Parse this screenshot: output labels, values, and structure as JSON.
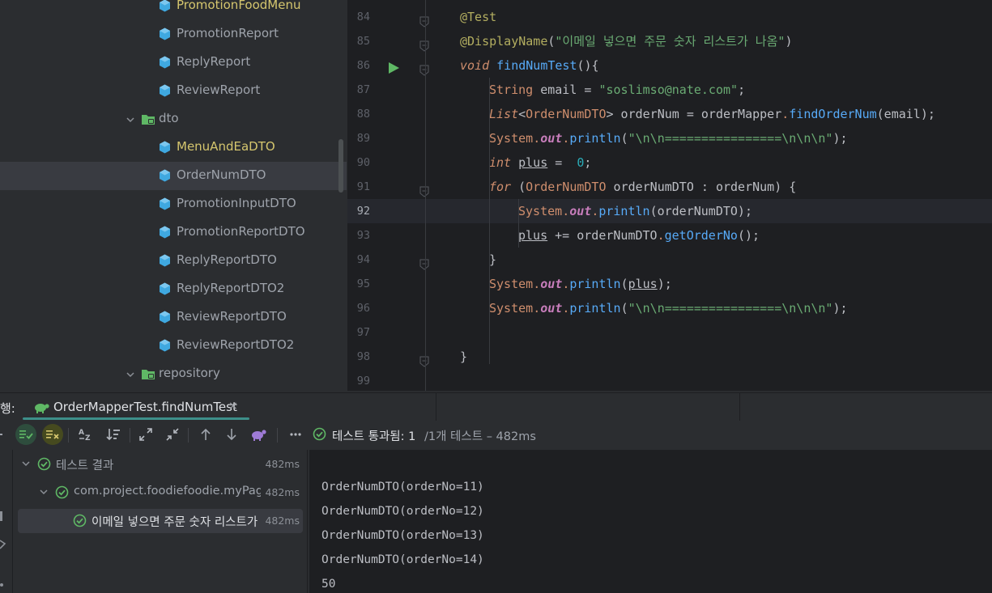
{
  "project_tree": {
    "items": [
      {
        "label": "PromotionFoodMenu",
        "kind": "class",
        "state": "modified"
      },
      {
        "label": "PromotionReport",
        "kind": "class",
        "state": "normal"
      },
      {
        "label": "ReplyReport",
        "kind": "class",
        "state": "normal"
      },
      {
        "label": "ReviewReport",
        "kind": "class",
        "state": "normal"
      },
      {
        "label": "dto",
        "kind": "package",
        "state": "normal"
      },
      {
        "label": "MenuAndEaDTO",
        "kind": "class",
        "state": "modified"
      },
      {
        "label": "OrderNumDTO",
        "kind": "class",
        "state": "selected"
      },
      {
        "label": "PromotionInputDTO",
        "kind": "class",
        "state": "normal"
      },
      {
        "label": "PromotionReportDTO",
        "kind": "class",
        "state": "normal"
      },
      {
        "label": "ReplyReportDTO",
        "kind": "class",
        "state": "normal"
      },
      {
        "label": "ReplyReportDTO2",
        "kind": "class",
        "state": "normal"
      },
      {
        "label": "ReviewReportDTO",
        "kind": "class",
        "state": "normal"
      },
      {
        "label": "ReviewReportDTO2",
        "kind": "class",
        "state": "normal"
      },
      {
        "label": "repository",
        "kind": "package",
        "state": "normal"
      }
    ]
  },
  "editor": {
    "current_line": "92",
    "lines": [
      {
        "n": "84",
        "indent": 1,
        "tokens": [
          [
            "ann",
            "@Test"
          ]
        ]
      },
      {
        "n": "85",
        "indent": 1,
        "tokens": [
          [
            "ann",
            "@DisplayName"
          ],
          [
            "p",
            "("
          ],
          [
            "str",
            "\"이메일 넣으면 주문 숫자 리스트가 나옴\""
          ],
          [
            "p",
            ")"
          ]
        ]
      },
      {
        "n": "86",
        "indent": 1,
        "tokens": [
          [
            "kwi",
            "void"
          ],
          [
            "p",
            " "
          ],
          [
            "fn",
            "findNumTest"
          ],
          [
            "p",
            "(){"
          ]
        ]
      },
      {
        "n": "87",
        "indent": 2,
        "tokens": [
          [
            "kw",
            "String"
          ],
          [
            "p",
            " email = "
          ],
          [
            "str",
            "\"soslimso@nate.com\""
          ],
          [
            "p",
            ";"
          ]
        ]
      },
      {
        "n": "88",
        "indent": 2,
        "tokens": [
          [
            "kwi",
            "List"
          ],
          [
            "p",
            "<"
          ],
          [
            "kw",
            "OrderNumDTO"
          ],
          [
            "p",
            "> orderNum = orderMapper"
          ],
          [
            "kw",
            "."
          ],
          [
            "fn",
            "findOrderNum"
          ],
          [
            "p",
            "(email);"
          ]
        ]
      },
      {
        "n": "89",
        "indent": 2,
        "tokens": [
          [
            "kw",
            "System"
          ],
          [
            "kw",
            "."
          ],
          [
            "fld",
            "out"
          ],
          [
            "kw",
            "."
          ],
          [
            "fn",
            "println"
          ],
          [
            "p",
            "("
          ],
          [
            "str",
            "\"\\n\\n================\\n\\n\\n\""
          ],
          [
            "p",
            ");"
          ]
        ]
      },
      {
        "n": "90",
        "indent": 2,
        "tokens": [
          [
            "kwi",
            "int"
          ],
          [
            "p",
            " "
          ],
          [
            "var",
            "plus"
          ],
          [
            "p",
            " =  "
          ],
          [
            "num",
            "0"
          ],
          [
            "p",
            ";"
          ]
        ]
      },
      {
        "n": "91",
        "indent": 2,
        "tokens": [
          [
            "kwi",
            "for"
          ],
          [
            "p",
            " ("
          ],
          [
            "kw",
            "OrderNumDTO"
          ],
          [
            "p",
            " orderNumDTO : orderNum) {"
          ]
        ]
      },
      {
        "n": "92",
        "indent": 3,
        "tokens": [
          [
            "kw",
            "System"
          ],
          [
            "kw",
            "."
          ],
          [
            "fld",
            "out"
          ],
          [
            "kw",
            "."
          ],
          [
            "fn",
            "println"
          ],
          [
            "p",
            "(orderNumDTO);"
          ]
        ]
      },
      {
        "n": "93",
        "indent": 3,
        "tokens": [
          [
            "var",
            "plus"
          ],
          [
            "p",
            " += orderNumDTO"
          ],
          [
            "kw",
            "."
          ],
          [
            "fn",
            "getOrderNo"
          ],
          [
            "p",
            "();"
          ]
        ]
      },
      {
        "n": "94",
        "indent": 2,
        "tokens": [
          [
            "p",
            "}"
          ]
        ]
      },
      {
        "n": "95",
        "indent": 2,
        "tokens": [
          [
            "kw",
            "System"
          ],
          [
            "kw",
            "."
          ],
          [
            "fld",
            "out"
          ],
          [
            "kw",
            "."
          ],
          [
            "fn",
            "println"
          ],
          [
            "p",
            "("
          ],
          [
            "var",
            "plus"
          ],
          [
            "p",
            ");"
          ]
        ]
      },
      {
        "n": "96",
        "indent": 2,
        "tokens": [
          [
            "kw",
            "System"
          ],
          [
            "kw",
            "."
          ],
          [
            "fld",
            "out"
          ],
          [
            "kw",
            "."
          ],
          [
            "fn",
            "println"
          ],
          [
            "p",
            "("
          ],
          [
            "str",
            "\"\\n\\n================\\n\\n\\n\""
          ],
          [
            "p",
            ");"
          ]
        ]
      },
      {
        "n": "97",
        "indent": 0,
        "tokens": []
      },
      {
        "n": "98",
        "indent": 1,
        "tokens": [
          [
            "p",
            "}"
          ]
        ]
      },
      {
        "n": "99",
        "indent": 0,
        "tokens": []
      }
    ]
  },
  "run_window": {
    "label": "행:",
    "tab_label": "OrderMapperTest.findNumTest",
    "tab_close": "×",
    "status_text": "테스트 통과됨: 1",
    "status_detail": "/1개 테스트 – 482ms",
    "results": [
      {
        "label": "테스트 결과",
        "time": "482ms",
        "level": 0
      },
      {
        "label": "com.project.foodiefoodie.myPage.re",
        "time": "482ms",
        "level": 1
      },
      {
        "label": "이메일 넣으면 주문 숫자 리스트가 나옴",
        "time": "482ms",
        "level": 2
      }
    ],
    "console_lines": [
      "",
      "OrderNumDTO(orderNo=11)",
      "OrderNumDTO(orderNo=12)",
      "OrderNumDTO(orderNo=13)",
      "OrderNumDTO(orderNo=14)",
      "50"
    ]
  },
  "colors": {
    "accent_green": "#5fb865",
    "tab_underline": "#3d8f8a",
    "class_icon": "#3fa8e0",
    "modified_text": "#d5c66e"
  }
}
